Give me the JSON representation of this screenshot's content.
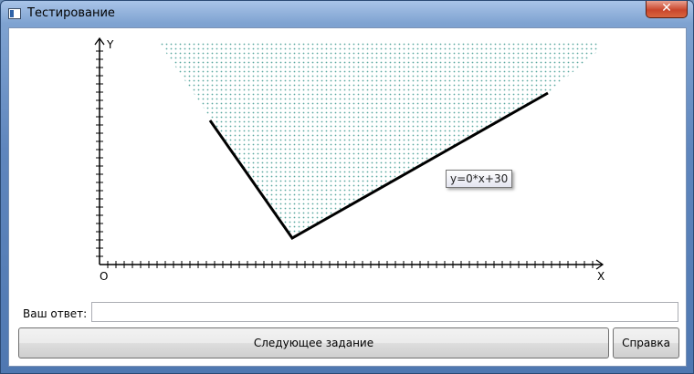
{
  "window": {
    "title": "Тестирование",
    "close_glyph": "✕"
  },
  "graph": {
    "y_label": "Y",
    "x_label": "X",
    "origin_label": "O",
    "function_tooltip": "y=0*x+30",
    "colors": {
      "dots": "#5aa8a0",
      "line": "#000000",
      "axis": "#000000"
    }
  },
  "answer": {
    "label": "Ваш ответ:",
    "value": "",
    "placeholder": ""
  },
  "buttons": {
    "next": "Следующее задание",
    "help": "Справка"
  }
}
